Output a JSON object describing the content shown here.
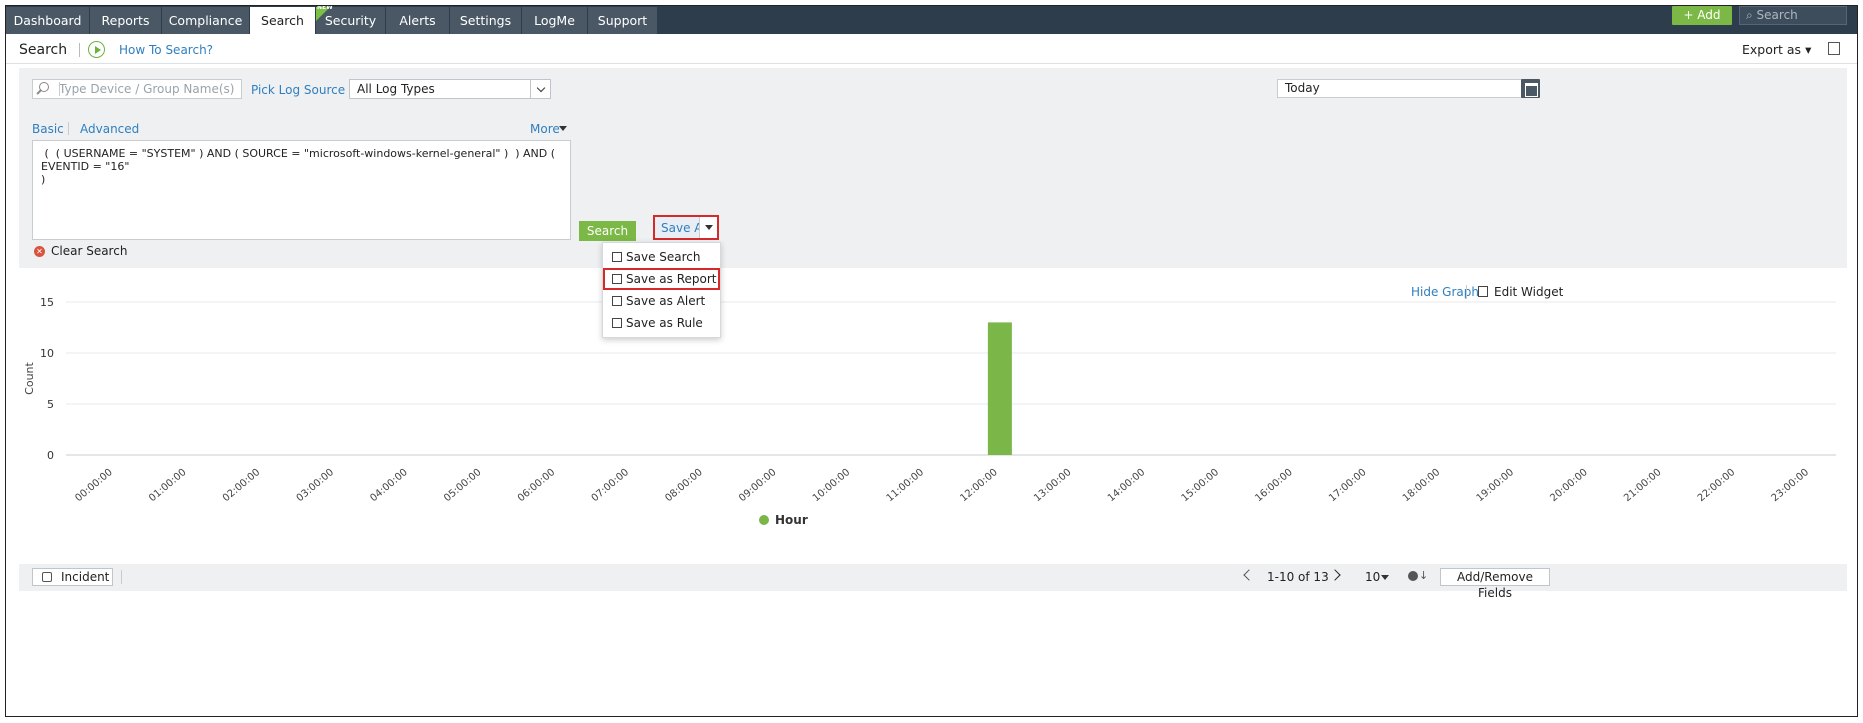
{
  "nav": {
    "tabs": [
      "Dashboard",
      "Reports",
      "Compliance",
      "Search",
      "Security",
      "Alerts",
      "Settings",
      "LogMe",
      "Support"
    ],
    "active": "Search",
    "new_badge": "NEW",
    "add_label": "+ Add",
    "search_placeholder": "Search"
  },
  "header": {
    "title": "Search",
    "how_to": "How To Search?",
    "export_label": "Export as"
  },
  "filters": {
    "device_placeholder": "Type Device / Group Name(s)",
    "pick_log_source": "Pick Log Source",
    "log_type": "All Log Types",
    "date_range": "Today"
  },
  "query": {
    "mode_basic": "Basic",
    "mode_advanced": "Advanced",
    "more_label": "More",
    "text": " (  ( USERNAME = \"SYSTEM\" ) AND ( SOURCE = \"microsoft-windows-kernel-general\" )  ) AND ( EVENTID = \"16\"\n)",
    "search_button": "Search",
    "save_as_button": "Save As",
    "clear_search": "Clear Search"
  },
  "save_menu": {
    "items": [
      "Save Search",
      "Save as Report",
      "Save as Alert",
      "Save as Rule"
    ],
    "highlighted": "Save as Report"
  },
  "graph": {
    "hide_graph": "Hide Graph",
    "edit_widget": "Edit Widget"
  },
  "chart_data": {
    "type": "bar",
    "categories": [
      "00:00:00",
      "01:00:00",
      "02:00:00",
      "03:00:00",
      "04:00:00",
      "05:00:00",
      "06:00:00",
      "07:00:00",
      "08:00:00",
      "09:00:00",
      "10:00:00",
      "11:00:00",
      "12:00:00",
      "13:00:00",
      "14:00:00",
      "15:00:00",
      "16:00:00",
      "17:00:00",
      "18:00:00",
      "19:00:00",
      "20:00:00",
      "21:00:00",
      "22:00:00",
      "23:00:00"
    ],
    "series": [
      {
        "name": "Hour",
        "values": [
          0,
          0,
          0,
          0,
          0,
          0,
          0,
          0,
          0,
          0,
          0,
          0,
          13,
          0,
          0,
          0,
          0,
          0,
          0,
          0,
          0,
          0,
          0,
          0
        ]
      }
    ],
    "ylabel": "Count",
    "yticks": [
      0,
      5,
      10,
      15
    ],
    "ylim": [
      0,
      15
    ],
    "color": "#7ab648",
    "grid": true,
    "legend": "bottom"
  },
  "footer": {
    "incident": "Incident",
    "pagination": "1-10 of 13",
    "page_size": "10",
    "add_remove_fields": "Add/Remove Fields"
  }
}
